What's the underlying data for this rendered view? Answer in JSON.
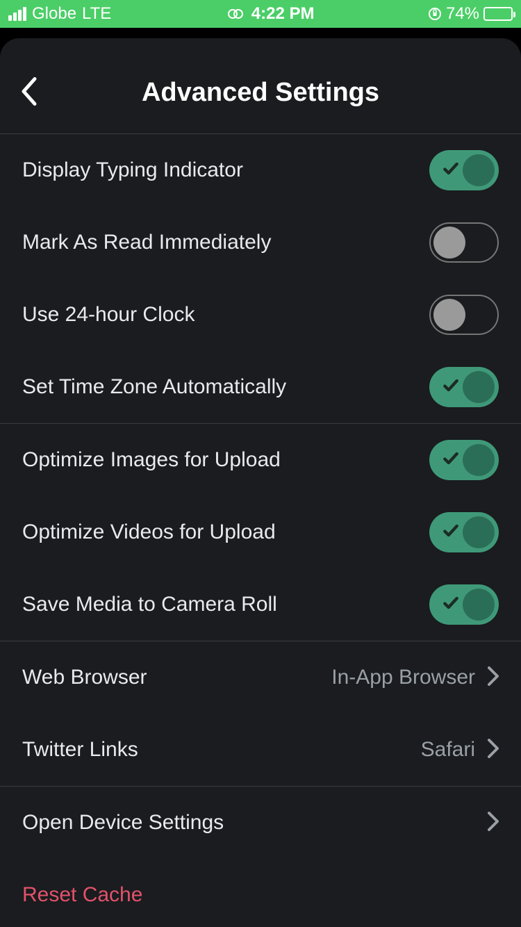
{
  "status": {
    "carrier": "Globe",
    "network": "LTE",
    "time": "4:22 PM",
    "battery_pct": "74%"
  },
  "header": {
    "title": "Advanced Settings"
  },
  "groups": {
    "g1": [
      {
        "label": "Display Typing Indicator",
        "on": true
      },
      {
        "label": "Mark As Read Immediately",
        "on": false
      },
      {
        "label": "Use 24-hour Clock",
        "on": false
      },
      {
        "label": "Set Time Zone Automatically",
        "on": true
      }
    ],
    "g2": [
      {
        "label": "Optimize Images for Upload",
        "on": true
      },
      {
        "label": "Optimize Videos for Upload",
        "on": true
      },
      {
        "label": "Save Media to Camera Roll",
        "on": true
      }
    ],
    "g3": [
      {
        "label": "Web Browser",
        "value": "In-App Browser"
      },
      {
        "label": "Twitter Links",
        "value": "Safari"
      }
    ],
    "g4": [
      {
        "label": "Open Device Settings"
      },
      {
        "label": "Reset Cache",
        "danger": true
      }
    ]
  }
}
